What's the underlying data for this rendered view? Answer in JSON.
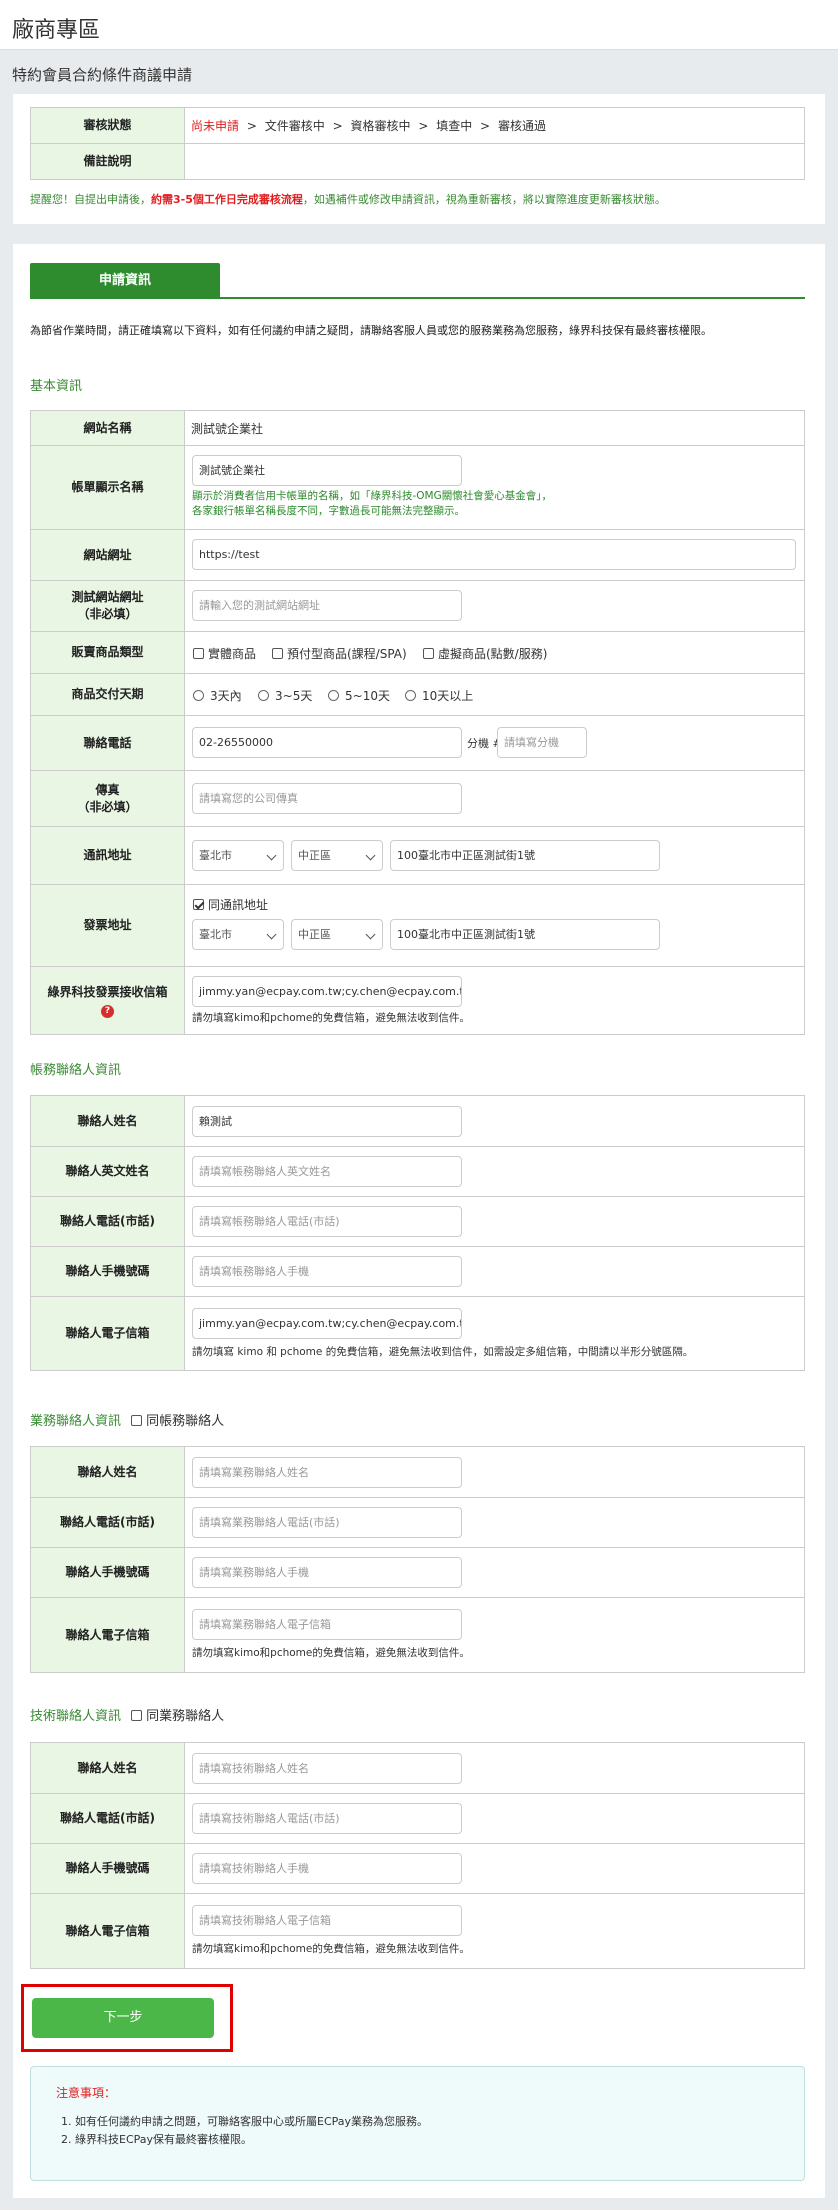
{
  "header": {
    "title": "廠商專區"
  },
  "subheader": {
    "title": "特約會員合約條件商議申請"
  },
  "status": {
    "label": "審核狀態",
    "steps": [
      "尚未申請",
      "文件審核中",
      "資格審核中",
      "填查中",
      "審核通過"
    ],
    "separator": ">",
    "remark_label": "備註說明",
    "remark_value": ""
  },
  "reminder": {
    "prefix": "提醒您！自提出申請後，",
    "highlight": "約需3-5個工作日完成審核流程",
    "suffix": "，如遇補件或修改申請資訊，視為重新審核，將以實際進度更新審核狀態。"
  },
  "tab": {
    "label": "申請資訊"
  },
  "intro": "為節省作業時間，請正確填寫以下資料，如有任何議約申請之疑問，請聯絡客服人員或您的服務業務為您服務，綠界科技保有最終審核權限。",
  "basic": {
    "title": "基本資訊",
    "site_name_label": "網站名稱",
    "site_name_value": "測試號企業社",
    "display_name_label": "帳單顯示名稱",
    "display_name_value": "測試號企業社",
    "display_name_note1": "顯示於消費者信用卡帳單的名稱，如「綠界科技-OMG關懷社會愛心基金會」，",
    "display_name_note2": "各家銀行帳單名稱長度不同，字數過長可能無法完整顯示。",
    "site_url_label": "網站網址",
    "site_url_value": "https://test",
    "test_url_label1": "測試網站網址",
    "test_url_label2": "（非必填）",
    "test_url_placeholder": "請輸入您的測試網站網址",
    "product_type_label": "販賣商品類型",
    "product_types": [
      "實體商品",
      "預付型商品(課程/SPA)",
      "虛擬商品(點數/服務)"
    ],
    "delivery_label": "商品交付天期",
    "delivery_options": [
      "3天內",
      "3~5天",
      "5~10天",
      "10天以上"
    ],
    "phone_label": "聯絡電話",
    "phone_value": "02-26550000",
    "ext_label": "分機 #",
    "ext_placeholder": "請填寫分機",
    "fax_label1": "傳真",
    "fax_label2": "（非必填）",
    "fax_placeholder": "請填寫您的公司傳真",
    "address_label": "通訊地址",
    "address_city": "臺北市",
    "address_district": "中正區",
    "address_value": "100臺北市中正區測試街1號",
    "invoice_label": "發票地址",
    "invoice_same_label": "同通訊地址",
    "invoice_city": "臺北市",
    "invoice_district": "中正區",
    "invoice_address": "100臺北市中正區測試街1號",
    "invoice_email_label": "綠界科技發票接收信箱",
    "invoice_email_value": "jimmy.yan@ecpay.com.tw;cy.chen@ecpay.com.tw",
    "invoice_email_note": "請勿填寫kimo和pchome的免費信箱，避免無法收到信件。",
    "help_glyph": "?"
  },
  "billing": {
    "title": "帳務聯絡人資訊",
    "name_label": "聯絡人姓名",
    "name_value": "賴測試",
    "en_name_label": "聯絡人英文姓名",
    "en_name_placeholder": "請填寫帳務聯絡人英文姓名",
    "tel_label": "聯絡人電話(市話)",
    "tel_placeholder": "請填寫帳務聯絡人電話(市話)",
    "mobile_label": "聯絡人手機號碼",
    "mobile_placeholder": "請填寫帳務聯絡人手機",
    "email_label": "聯絡人電子信箱",
    "email_value": "jimmy.yan@ecpay.com.tw;cy.chen@ecpay.com.tw",
    "email_note": "請勿填寫 kimo 和 pchome 的免費信箱，避免無法收到信件，如需設定多組信箱，中間請以半形分號區隔。"
  },
  "sales": {
    "title": "業務聯絡人資訊",
    "same_label": "同帳務聯絡人",
    "name_label": "聯絡人姓名",
    "name_placeholder": "請填寫業務聯絡人姓名",
    "tel_label": "聯絡人電話(市話)",
    "tel_placeholder": "請填寫業務聯絡人電話(市話)",
    "mobile_label": "聯絡人手機號碼",
    "mobile_placeholder": "請填寫業務聯絡人手機",
    "email_label": "聯絡人電子信箱",
    "email_placeholder": "請填寫業務聯絡人電子信箱",
    "email_note": "請勿填寫kimo和pchome的免費信箱，避免無法收到信件。"
  },
  "tech": {
    "title": "技術聯絡人資訊",
    "same_label": "同業務聯絡人",
    "name_label": "聯絡人姓名",
    "name_placeholder": "請填寫技術聯絡人姓名",
    "tel_label": "聯絡人電話(市話)",
    "tel_placeholder": "請填寫技術聯絡人電話(市話)",
    "mobile_label": "聯絡人手機號碼",
    "mobile_placeholder": "請填寫技術聯絡人手機",
    "email_label": "聯絡人電子信箱",
    "email_placeholder": "請填寫技術聯絡人電子信箱",
    "email_note": "請勿填寫kimo和pchome的免費信箱，避免無法收到信件。"
  },
  "next_button": "下一步",
  "notice": {
    "title": "注意事項：",
    "items": [
      "1. 如有任何議約申請之問題，可聯絡客服中心或所屬ECPay業務為您服務。",
      "2. 綠界科技ECPay保有最終審核權限。"
    ]
  },
  "colors": {
    "accent_green": "#2e8b2e",
    "button_green": "#4cb749",
    "highlight_red": "#e02020",
    "label_bg": "#e9f6e3"
  }
}
